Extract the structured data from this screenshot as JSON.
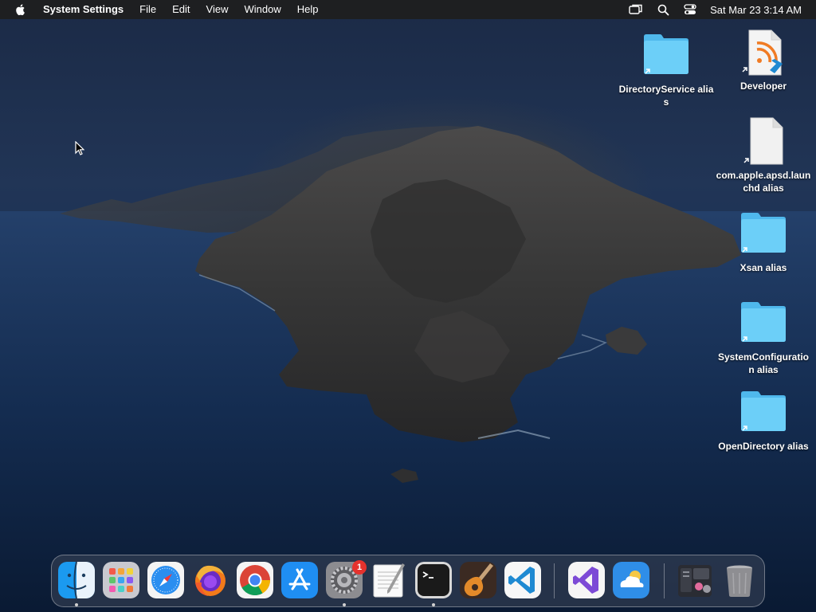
{
  "menubar": {
    "app_name": "System Settings",
    "items": [
      "File",
      "Edit",
      "View",
      "Window",
      "Help"
    ],
    "status_icons": [
      "screen-mirroring-icon",
      "spotlight-search-icon",
      "control-center-icon"
    ],
    "clock": "Sat Mar 23  3:14 AM"
  },
  "desktop": {
    "icons": [
      {
        "label": "DirectoryService alias",
        "icon": "folder-alias-icon"
      },
      {
        "label": "Developer",
        "icon": "developer-document-icon"
      },
      {
        "label": "com.apple.apsd.launchd alias",
        "icon": "document-alias-icon"
      },
      {
        "label": "Xsan alias",
        "icon": "folder-alias-icon"
      },
      {
        "label": "SystemConfiguration alias",
        "icon": "folder-alias-icon"
      },
      {
        "label": "OpenDirectory alias",
        "icon": "folder-alias-icon"
      }
    ]
  },
  "dock": {
    "apps": [
      {
        "name": "Finder",
        "icon": "finder-icon",
        "running": true
      },
      {
        "name": "Launchpad",
        "icon": "launchpad-icon",
        "running": false
      },
      {
        "name": "Safari",
        "icon": "safari-icon",
        "running": false
      },
      {
        "name": "Firefox",
        "icon": "firefox-icon",
        "running": false
      },
      {
        "name": "Chrome",
        "icon": "chrome-icon",
        "running": false
      },
      {
        "name": "App Store",
        "icon": "app-store-icon",
        "running": false
      },
      {
        "name": "System Settings",
        "icon": "system-settings-icon",
        "running": true,
        "badge": "1"
      },
      {
        "name": "TextEdit",
        "icon": "textedit-icon",
        "running": false
      },
      {
        "name": "Terminal",
        "icon": "terminal-icon",
        "running": true
      },
      {
        "name": "GarageBand",
        "icon": "garageband-icon",
        "running": false
      },
      {
        "name": "Visual Studio Code",
        "icon": "vscode-icon",
        "running": false
      },
      {
        "name": "Visual Studio",
        "icon": "visual-studio-icon",
        "running": false
      },
      {
        "name": "Weather",
        "icon": "weather-icon",
        "running": false
      },
      {
        "name": "Downloads",
        "icon": "downloads-stack-icon",
        "running": false
      },
      {
        "name": "Trash",
        "icon": "trash-icon",
        "running": false
      }
    ]
  },
  "colors": {
    "folder_blue": "#5ec6f5",
    "menubar_bg": "#1e1e1e",
    "badge_red": "#e5322d"
  }
}
